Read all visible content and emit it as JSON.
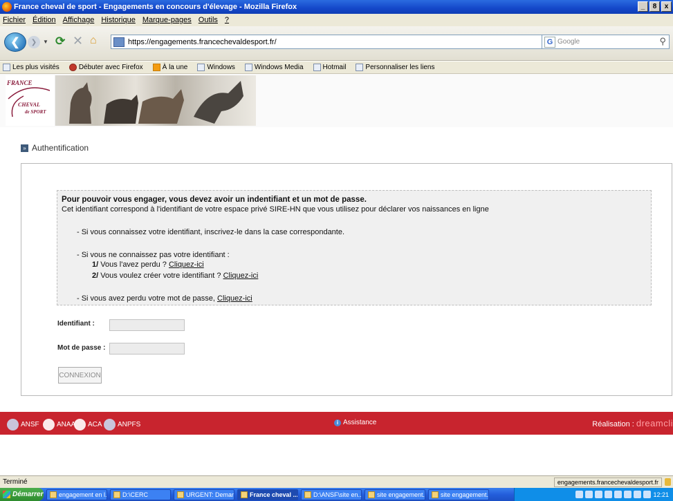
{
  "window": {
    "title": "France cheval de sport - Engagements en concours d'élevage - Mozilla Firefox",
    "controls": [
      "_",
      "8",
      "x"
    ]
  },
  "menu": [
    "Fichier",
    "Édition",
    "Affichage",
    "Historique",
    "Marque-pages",
    "Outils",
    "?"
  ],
  "toolbar": {
    "url": "https://engagements.francechevaldesport.fr/",
    "search_placeholder": "Google"
  },
  "bookmarks": [
    {
      "label": "Les plus visités",
      "icon": "bookmarks-icon"
    },
    {
      "label": "Débuter avec Firefox",
      "icon": "firefox-icon"
    },
    {
      "label": "À la une",
      "icon": "rss-icon"
    },
    {
      "label": "Windows",
      "icon": "page-icon"
    },
    {
      "label": "Windows Media",
      "icon": "windows-media-icon"
    },
    {
      "label": "Hotmail",
      "icon": "page-icon"
    },
    {
      "label": "Personnaliser les liens",
      "icon": "page-icon"
    }
  ],
  "logo": {
    "line1": "FRANCE",
    "line2": "CHEVAL",
    "line3": "de SPORT"
  },
  "page": {
    "section_title": "Authentification",
    "info": {
      "heading": "Pour pouvoir vous engager, vous devez avoir un indentifiant et un mot de passe.",
      "subheading": "Cet identifiant correspond à l'identifiant de votre espace privé SIRE-HN que vous utilisez pour déclarer vos naissances en ligne",
      "item1": "- Si vous connaissez votre identifiant, inscrivez-le dans la case correspondante.",
      "item2": "- Si vous ne connaissez pas votre identifiant :",
      "sub1_num": "1/",
      "sub1_text": "Vous l'avez perdu ?",
      "sub2_num": "2/",
      "sub2_text": "Vous voulez créer votre identifiant ?",
      "item3": "- Si vous avez perdu votre mot de passe,",
      "link_label": "Cliquez-ici"
    },
    "form": {
      "id_label": "Identifiant :",
      "id_value": "",
      "pw_label": "Mot de passe :",
      "pw_value": "",
      "submit": "CONNEXION"
    }
  },
  "footer": {
    "partners": [
      "ANSF",
      "ANAA",
      "ACA",
      "ANPFS"
    ],
    "assistance": "Assistance",
    "realisation_label": "Réalisation :",
    "realisation_brand": "dreamcli"
  },
  "status": {
    "text": "Terminé",
    "domain": "engagements.francechevaldesport.fr"
  },
  "taskbar": {
    "start": "Démarrer",
    "tasks": [
      {
        "label": "engagement en l...",
        "active": false
      },
      {
        "label": "D:\\CERC",
        "active": false
      },
      {
        "label": "URGENT: Deman...",
        "active": false
      },
      {
        "label": "France cheval ...",
        "active": true
      },
      {
        "label": "D:\\ANSF\\site en...",
        "active": false
      },
      {
        "label": "site engagement...",
        "active": false
      },
      {
        "label": "site engagement...",
        "active": false
      }
    ],
    "clock": "12:21"
  }
}
